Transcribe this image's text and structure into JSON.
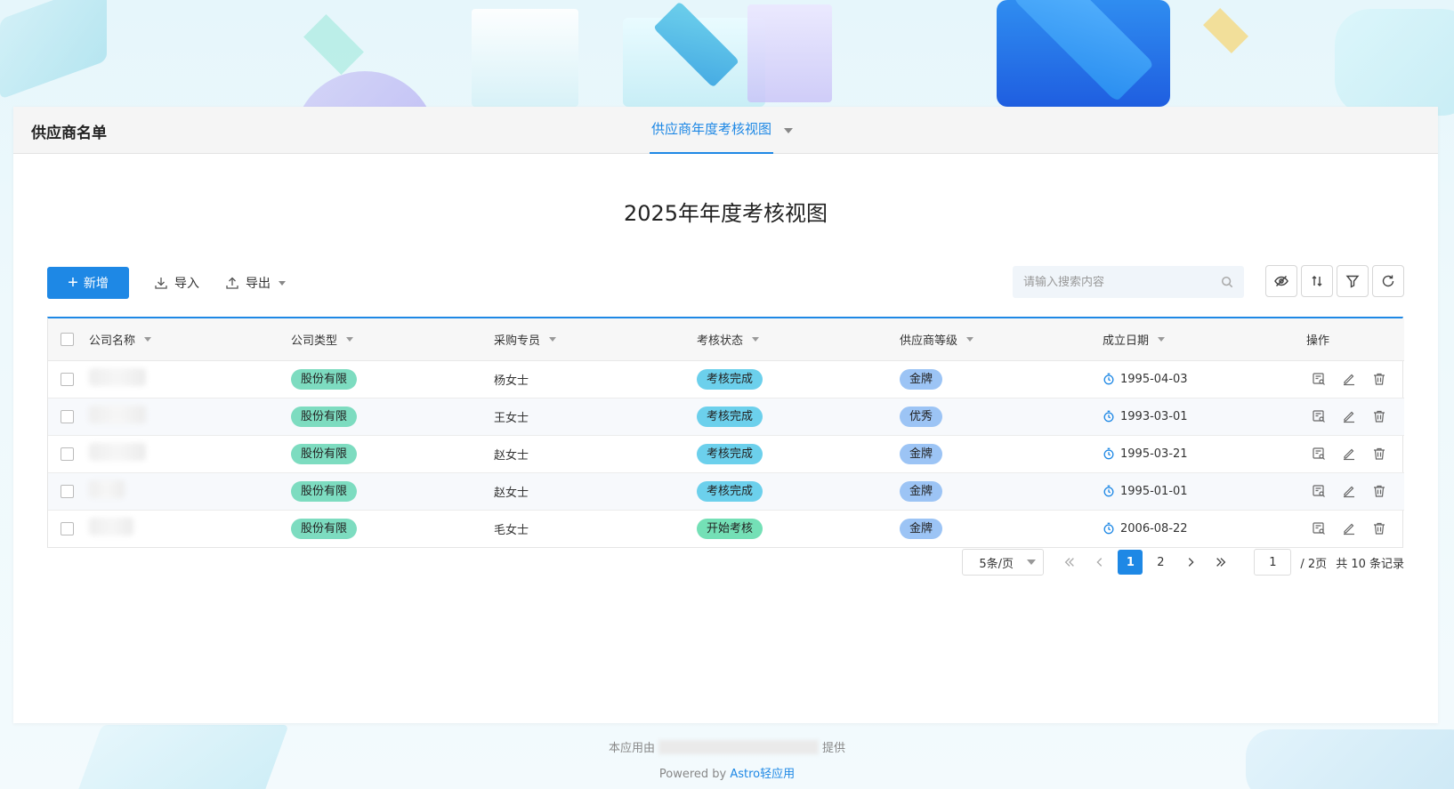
{
  "app": {
    "title": "供应商名单",
    "view_tab": "供应商年度考核视图"
  },
  "view_heading": "2025年年度考核视图",
  "toolbar": {
    "add_label": "新增",
    "import_label": "导入",
    "export_label": "导出",
    "search_placeholder": "请输入搜索内容"
  },
  "table": {
    "columns": [
      "公司名称",
      "公司类型",
      "采购专员",
      "考核状态",
      "供应商等级",
      "成立日期",
      "操作"
    ],
    "rows": [
      {
        "company_type": "股份有限",
        "buyer": "杨女士",
        "status": "考核完成",
        "level": "金牌",
        "date": "1995-04-03"
      },
      {
        "company_type": "股份有限",
        "buyer": "王女士",
        "status": "考核完成",
        "level": "优秀",
        "date": "1993-03-01"
      },
      {
        "company_type": "股份有限",
        "buyer": "赵女士",
        "status": "考核完成",
        "level": "金牌",
        "date": "1995-03-21"
      },
      {
        "company_type": "股份有限",
        "buyer": "赵女士",
        "status": "考核完成",
        "level": "金牌",
        "date": "1995-01-01"
      },
      {
        "company_type": "股份有限",
        "buyer": "毛女士",
        "status": "开始考核",
        "level": "金牌",
        "date": "2006-08-22"
      }
    ]
  },
  "pager": {
    "page_size": "5条/页",
    "pages": [
      "1",
      "2"
    ],
    "current_page": "1",
    "page_input": "1",
    "total_pages": "/ 2页",
    "total_records": "共 10 条记录"
  },
  "footer": {
    "provided_prefix": "本应用由",
    "provided_suffix": "提供",
    "powered_by": "Powered by",
    "brand": "Astro轻应用"
  },
  "colors": {
    "accent": "#1e88e5",
    "tag_company_type": "#7ddcc0",
    "tag_status": "#6cd0ec",
    "tag_status_start": "#74e0b6",
    "tag_level": "#9cc4f5"
  }
}
